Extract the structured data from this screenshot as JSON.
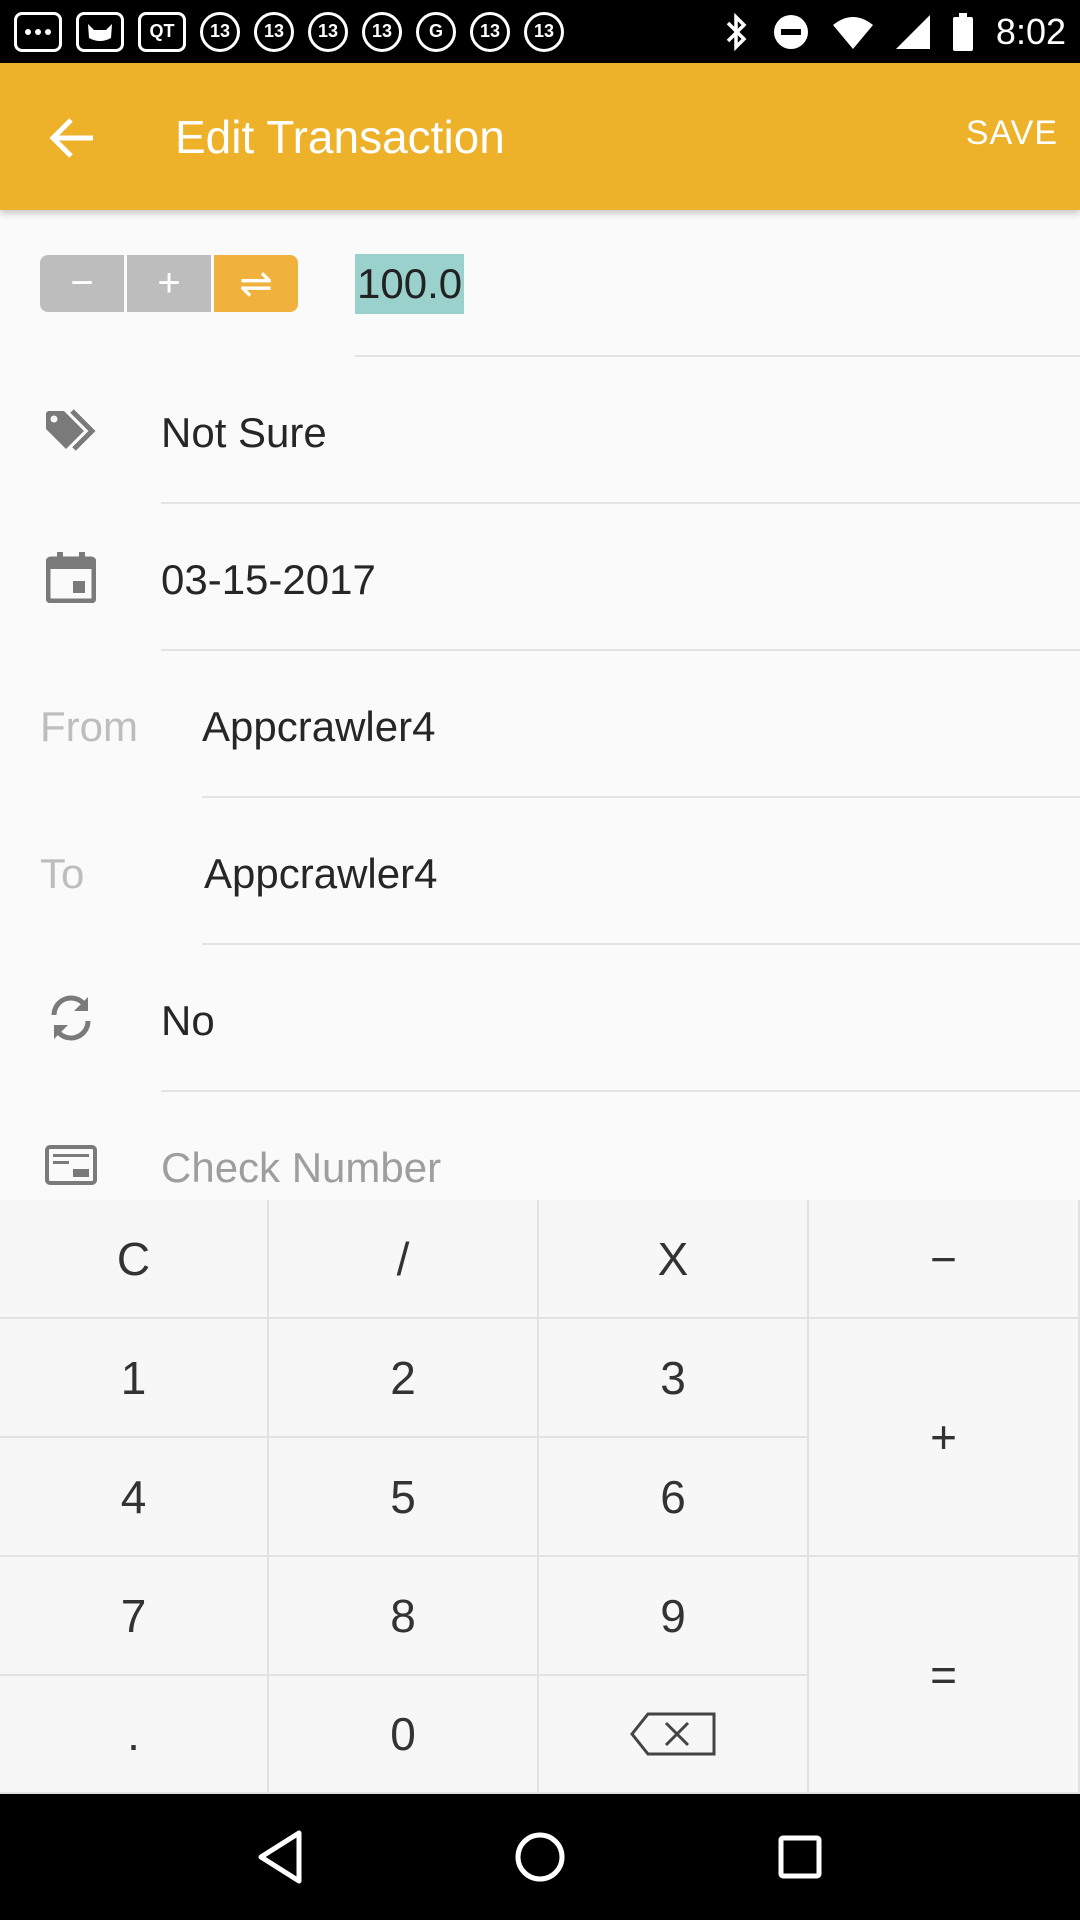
{
  "status_bar": {
    "time": "8:02",
    "icons": [
      "sms-icon",
      "cat-icon",
      "qt-icon",
      "abc13-icon",
      "abc13-icon",
      "abc13-icon",
      "abc13-icon",
      "g-icon",
      "abc13-icon",
      "abc13-icon",
      "bluetooth-icon",
      "dnd-icon",
      "wifi-icon",
      "signal-icon",
      "battery-icon"
    ],
    "labels": {
      "qt": "QT",
      "abc": "13",
      "g": "G"
    }
  },
  "app_bar": {
    "title": "Edit Transaction",
    "save_label": "SAVE",
    "background": "#edb12a"
  },
  "amount_row": {
    "segments": [
      "−",
      "+",
      "⇌"
    ],
    "selected_segment": 2,
    "amount": "100.0"
  },
  "form": {
    "category": "Not Sure",
    "date": "03-15-2017",
    "from_label": "From",
    "from_value": "Appcrawler4",
    "to_label": "To",
    "to_value": "Appcrawler4",
    "recurring": "No",
    "check_number_placeholder": "Check Number"
  },
  "keypad": {
    "row1": [
      "C",
      "/",
      "X",
      "−"
    ],
    "row2": [
      "1",
      "2",
      "3"
    ],
    "row3": [
      "4",
      "5",
      "6"
    ],
    "row4": [
      "7",
      "8",
      "9"
    ],
    "row5": [
      ".",
      "0"
    ],
    "plus": "+",
    "equals": "="
  }
}
